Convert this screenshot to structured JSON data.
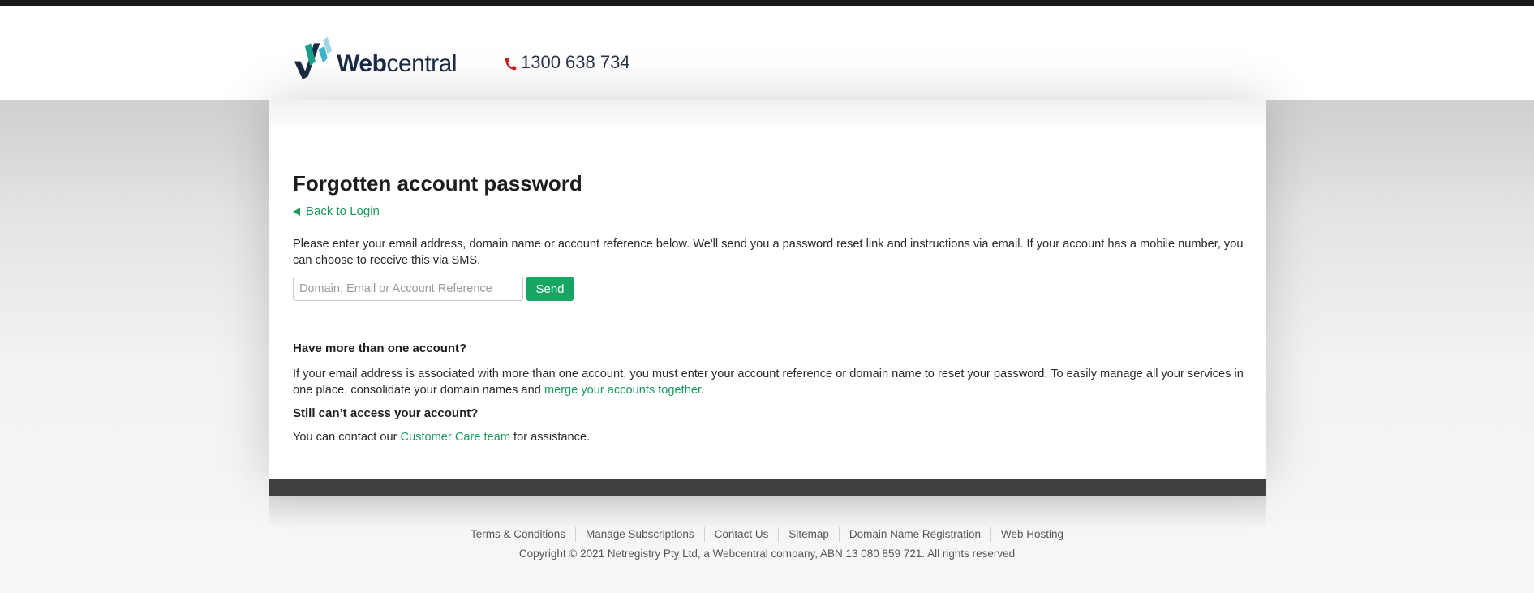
{
  "header": {
    "logo_text_bold": "Web",
    "logo_text_light": "central",
    "phone": "1300 638 734",
    "phone_icon": "phone-icon"
  },
  "page": {
    "title": "Forgotten account password",
    "back_link": "Back to Login",
    "intro": "Please enter your email address, domain name or account reference below. We'll send you a password reset link and instructions via email. If your account has a mobile number, you can choose to receive this via SMS."
  },
  "form": {
    "placeholder": "Domain, Email or Account Reference",
    "value": "",
    "send_label": "Send"
  },
  "more_accounts": {
    "heading": "Have more than one account?",
    "text_before": "If your email address is associated with more than one account, you must enter your account reference or domain name to reset your password. To easily manage all your services in one place, consolidate your domain names and ",
    "link": "merge your accounts together",
    "text_after": "."
  },
  "still": {
    "heading": "Still can’t access your account?",
    "text_before": "You can contact our ",
    "link": "Customer Care team",
    "text_after": " for assistance."
  },
  "footer": {
    "links": [
      "Terms & Conditions",
      "Manage Subscriptions",
      "Contact Us",
      "Sitemap",
      "Domain Name Registration",
      "Web Hosting"
    ],
    "copyright": "Copyright © 2021 Netregistry Pty Ltd, a Webcentral company, ABN 13 080 859 721. All rights reserved"
  },
  "colors": {
    "accent": "#17a563",
    "link": "#1a9b5a",
    "topbar": "#1a1a1a",
    "footer_bar": "#404040"
  }
}
